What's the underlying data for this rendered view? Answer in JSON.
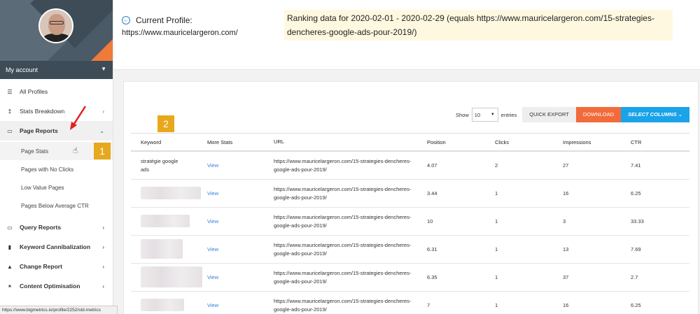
{
  "sidebar": {
    "account_label": "My account",
    "items": [
      {
        "label": "All Profiles",
        "icon": "list-icon"
      },
      {
        "label": "Stats Breakdown",
        "icon": "chart-icon"
      },
      {
        "label": "Page Reports",
        "icon": "page-icon"
      },
      {
        "label": "Query Reports",
        "icon": "query-icon"
      },
      {
        "label": "Keyword Cannibalization",
        "icon": "copy-icon"
      },
      {
        "label": "Change Report",
        "icon": "flask-icon"
      },
      {
        "label": "Content Optimisation",
        "icon": "star-icon"
      }
    ],
    "sub_items": [
      {
        "label": "Page Stats"
      },
      {
        "label": "Pages with No Clicks"
      },
      {
        "label": "Low Value Pages"
      },
      {
        "label": "Pages Below Average CTR"
      }
    ]
  },
  "header": {
    "profile_label": "Current Profile:",
    "profile_url": "https://www.mauricelargeron.com/",
    "ranking_text": "Ranking data for 2020-02-01 - 2020-02-29 (equals https://www.mauricelargeron.com/15-strategies-dencheres-google-ads-pour-2019/)"
  },
  "controls": {
    "show_label": "Show",
    "entries_value": "10",
    "entries_label": "entries",
    "quick_export": "QUICK EXPORT",
    "download": "DOWNLOAD",
    "select_columns": "SELECT COLUMNS"
  },
  "annotations": {
    "badge_1": "1",
    "badge_2": "2"
  },
  "table": {
    "headers": [
      "Keyword",
      "More Stats",
      "URL",
      "Position",
      "Clicks",
      "Impressions",
      "CTR"
    ],
    "rows": [
      {
        "keyword": "stratégie google ads",
        "more": "View",
        "url": "https://www.mauricelargeron.com/15-strategies-dencheres-google-ads-pour-2019/",
        "position": "4.07",
        "clicks": "2",
        "impressions": "27",
        "ctr": "7.41"
      },
      {
        "keyword": "",
        "more": "View",
        "url": "https://www.mauricelargeron.com/15-strategies-dencheres-google-ads-pour-2019/",
        "position": "3.44",
        "clicks": "1",
        "impressions": "16",
        "ctr": "6.25"
      },
      {
        "keyword": "",
        "more": "View",
        "url": "https://www.mauricelargeron.com/15-strategies-dencheres-google-ads-pour-2019/",
        "position": "10",
        "clicks": "1",
        "impressions": "3",
        "ctr": "33.33"
      },
      {
        "keyword": "",
        "more": "View",
        "url": "https://www.mauricelargeron.com/15-strategies-dencheres-google-ads-pour-2019/",
        "position": "6.31",
        "clicks": "1",
        "impressions": "13",
        "ctr": "7.69"
      },
      {
        "keyword": "",
        "more": "View",
        "url": "https://www.mauricelargeron.com/15-strategies-dencheres-google-ads-pour-2019/",
        "position": "6.35",
        "clicks": "1",
        "impressions": "37",
        "ctr": "2.7"
      },
      {
        "keyword": "",
        "more": "View",
        "url": "https://www.mauricelargeron.com/15-strategies-dencheres-google-ads-pour-2019/",
        "position": "7",
        "clicks": "1",
        "impressions": "16",
        "ctr": "6.25"
      }
    ]
  },
  "status_bar": {
    "url": "https://www.bigmetrics.io/profile/2252/std-metrics"
  },
  "colors": {
    "accent": "#1aa3e8",
    "download": "#f26b3a",
    "badge": "#e8a81c",
    "arrow": "#e02020"
  }
}
